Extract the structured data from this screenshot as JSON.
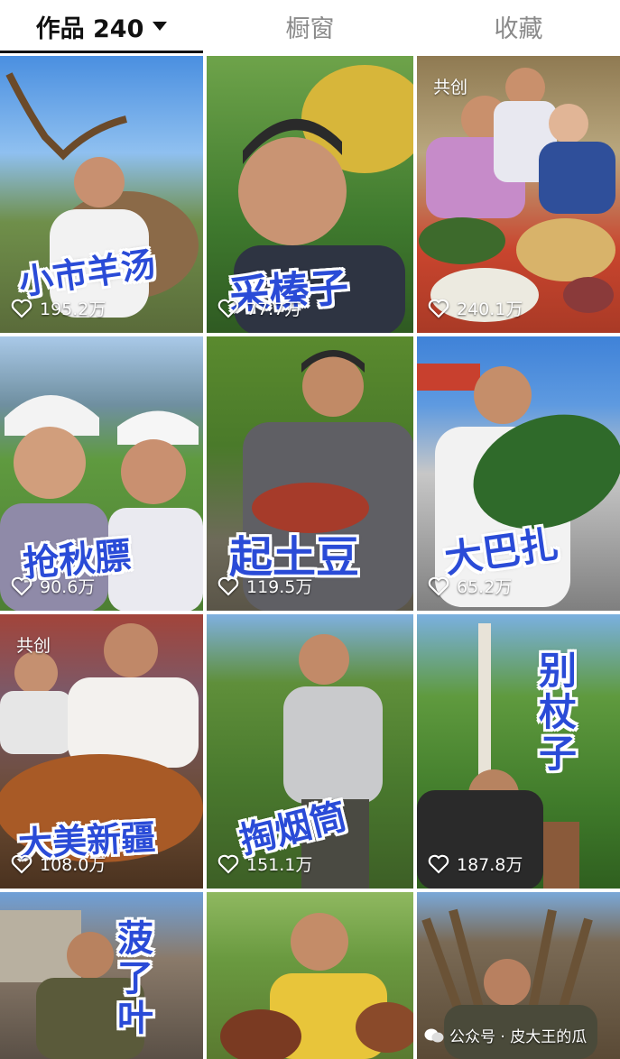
{
  "tabs": [
    {
      "label": "作品 240",
      "active": true
    },
    {
      "label": "橱窗",
      "active": false
    },
    {
      "label": "收藏",
      "active": false
    }
  ],
  "videos": [
    {
      "caption": "小市羊汤",
      "likes": "195.2万",
      "co_create": ""
    },
    {
      "caption": "采榛子",
      "likes": "77.7万",
      "co_create": ""
    },
    {
      "caption": "",
      "likes": "240.1万",
      "co_create": "共创"
    },
    {
      "caption": "抢秋膘",
      "likes": "90.6万",
      "co_create": ""
    },
    {
      "caption": "起土豆",
      "likes": "119.5万",
      "co_create": ""
    },
    {
      "caption": "大巴扎",
      "likes": "65.2万",
      "co_create": ""
    },
    {
      "caption": "大美新疆",
      "likes": "108.0万",
      "co_create": "共创"
    },
    {
      "caption": "掏烟筒",
      "likes": "151.1万",
      "co_create": ""
    },
    {
      "caption": "别杖子",
      "likes": "187.8万",
      "co_create": ""
    },
    {
      "caption": "菠了叶",
      "likes": "",
      "co_create": ""
    },
    {
      "caption": "",
      "likes": "",
      "co_create": ""
    },
    {
      "caption": "",
      "likes": "",
      "co_create": ""
    }
  ],
  "watermark": "公众号 · 皮大王的瓜",
  "colors": {
    "caption_blue": "#2a4bd7",
    "tab_active": "#111111",
    "tab_inactive": "#8a8a8a"
  }
}
